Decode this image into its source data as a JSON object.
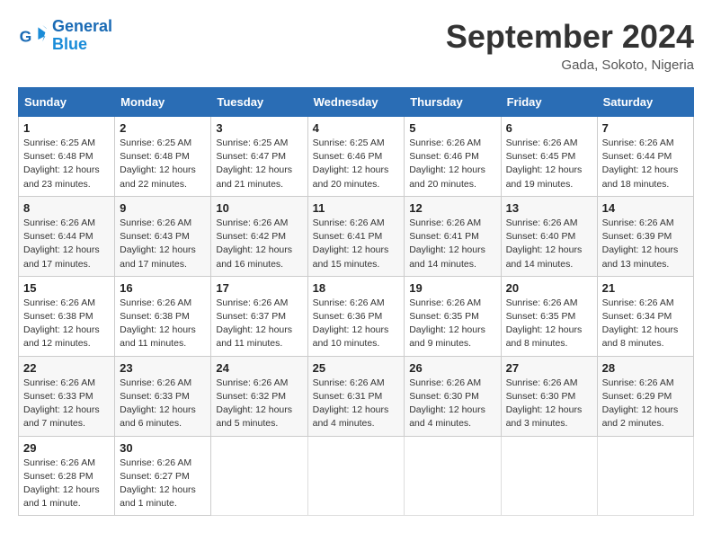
{
  "header": {
    "logo_line1": "General",
    "logo_line2": "Blue",
    "month": "September 2024",
    "location": "Gada, Sokoto, Nigeria"
  },
  "days_of_week": [
    "Sunday",
    "Monday",
    "Tuesday",
    "Wednesday",
    "Thursday",
    "Friday",
    "Saturday"
  ],
  "weeks": [
    [
      {
        "day": "1",
        "sunrise": "6:25 AM",
        "sunset": "6:48 PM",
        "daylight": "12 hours and 23 minutes."
      },
      {
        "day": "2",
        "sunrise": "6:25 AM",
        "sunset": "6:48 PM",
        "daylight": "12 hours and 22 minutes."
      },
      {
        "day": "3",
        "sunrise": "6:25 AM",
        "sunset": "6:47 PM",
        "daylight": "12 hours and 21 minutes."
      },
      {
        "day": "4",
        "sunrise": "6:25 AM",
        "sunset": "6:46 PM",
        "daylight": "12 hours and 20 minutes."
      },
      {
        "day": "5",
        "sunrise": "6:26 AM",
        "sunset": "6:46 PM",
        "daylight": "12 hours and 20 minutes."
      },
      {
        "day": "6",
        "sunrise": "6:26 AM",
        "sunset": "6:45 PM",
        "daylight": "12 hours and 19 minutes."
      },
      {
        "day": "7",
        "sunrise": "6:26 AM",
        "sunset": "6:44 PM",
        "daylight": "12 hours and 18 minutes."
      }
    ],
    [
      {
        "day": "8",
        "sunrise": "6:26 AM",
        "sunset": "6:44 PM",
        "daylight": "12 hours and 17 minutes."
      },
      {
        "day": "9",
        "sunrise": "6:26 AM",
        "sunset": "6:43 PM",
        "daylight": "12 hours and 17 minutes."
      },
      {
        "day": "10",
        "sunrise": "6:26 AM",
        "sunset": "6:42 PM",
        "daylight": "12 hours and 16 minutes."
      },
      {
        "day": "11",
        "sunrise": "6:26 AM",
        "sunset": "6:41 PM",
        "daylight": "12 hours and 15 minutes."
      },
      {
        "day": "12",
        "sunrise": "6:26 AM",
        "sunset": "6:41 PM",
        "daylight": "12 hours and 14 minutes."
      },
      {
        "day": "13",
        "sunrise": "6:26 AM",
        "sunset": "6:40 PM",
        "daylight": "12 hours and 14 minutes."
      },
      {
        "day": "14",
        "sunrise": "6:26 AM",
        "sunset": "6:39 PM",
        "daylight": "12 hours and 13 minutes."
      }
    ],
    [
      {
        "day": "15",
        "sunrise": "6:26 AM",
        "sunset": "6:38 PM",
        "daylight": "12 hours and 12 minutes."
      },
      {
        "day": "16",
        "sunrise": "6:26 AM",
        "sunset": "6:38 PM",
        "daylight": "12 hours and 11 minutes."
      },
      {
        "day": "17",
        "sunrise": "6:26 AM",
        "sunset": "6:37 PM",
        "daylight": "12 hours and 11 minutes."
      },
      {
        "day": "18",
        "sunrise": "6:26 AM",
        "sunset": "6:36 PM",
        "daylight": "12 hours and 10 minutes."
      },
      {
        "day": "19",
        "sunrise": "6:26 AM",
        "sunset": "6:35 PM",
        "daylight": "12 hours and 9 minutes."
      },
      {
        "day": "20",
        "sunrise": "6:26 AM",
        "sunset": "6:35 PM",
        "daylight": "12 hours and 8 minutes."
      },
      {
        "day": "21",
        "sunrise": "6:26 AM",
        "sunset": "6:34 PM",
        "daylight": "12 hours and 8 minutes."
      }
    ],
    [
      {
        "day": "22",
        "sunrise": "6:26 AM",
        "sunset": "6:33 PM",
        "daylight": "12 hours and 7 minutes."
      },
      {
        "day": "23",
        "sunrise": "6:26 AM",
        "sunset": "6:33 PM",
        "daylight": "12 hours and 6 minutes."
      },
      {
        "day": "24",
        "sunrise": "6:26 AM",
        "sunset": "6:32 PM",
        "daylight": "12 hours and 5 minutes."
      },
      {
        "day": "25",
        "sunrise": "6:26 AM",
        "sunset": "6:31 PM",
        "daylight": "12 hours and 4 minutes."
      },
      {
        "day": "26",
        "sunrise": "6:26 AM",
        "sunset": "6:30 PM",
        "daylight": "12 hours and 4 minutes."
      },
      {
        "day": "27",
        "sunrise": "6:26 AM",
        "sunset": "6:30 PM",
        "daylight": "12 hours and 3 minutes."
      },
      {
        "day": "28",
        "sunrise": "6:26 AM",
        "sunset": "6:29 PM",
        "daylight": "12 hours and 2 minutes."
      }
    ],
    [
      {
        "day": "29",
        "sunrise": "6:26 AM",
        "sunset": "6:28 PM",
        "daylight": "12 hours and 1 minute."
      },
      {
        "day": "30",
        "sunrise": "6:26 AM",
        "sunset": "6:27 PM",
        "daylight": "12 hours and 1 minute."
      },
      null,
      null,
      null,
      null,
      null
    ]
  ]
}
